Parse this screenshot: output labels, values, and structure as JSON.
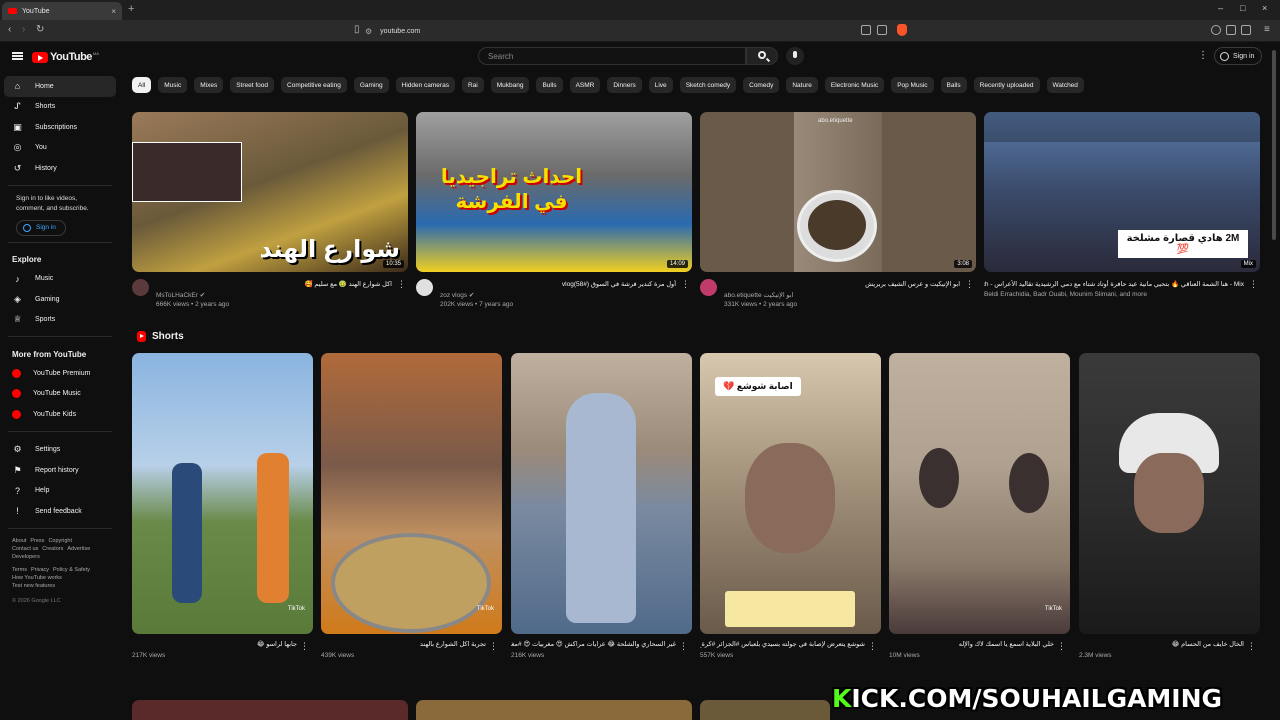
{
  "browser": {
    "tab_title": "YouTube",
    "tab_close": "×",
    "new_tab": "+",
    "url": "youtube.com",
    "window_controls": [
      "–",
      "□",
      "×"
    ]
  },
  "header": {
    "logo_text": "YouTube",
    "logo_region": "MA",
    "search_placeholder": "Search",
    "signin_label": "Sign in"
  },
  "sidebar": {
    "main": [
      {
        "label": "Home",
        "icon": "home-icon"
      },
      {
        "label": "Shorts",
        "icon": "shorts-icon"
      },
      {
        "label": "Subscriptions",
        "icon": "subscriptions-icon"
      },
      {
        "label": "You",
        "icon": "you-icon"
      },
      {
        "label": "History",
        "icon": "history-icon"
      }
    ],
    "signin_note": "Sign in to like videos, comment, and subscribe.",
    "signin_button": "Sign in",
    "explore_heading": "Explore",
    "explore": [
      {
        "label": "Music",
        "icon": "music-icon"
      },
      {
        "label": "Gaming",
        "icon": "gaming-icon"
      },
      {
        "label": "Sports",
        "icon": "trophy-icon"
      }
    ],
    "more_heading": "More from YouTube",
    "more": [
      {
        "label": "YouTube Premium"
      },
      {
        "label": "YouTube Music"
      },
      {
        "label": "YouTube Kids"
      }
    ],
    "settings": [
      {
        "label": "Settings",
        "icon": "gear-icon"
      },
      {
        "label": "Report history",
        "icon": "flag-icon"
      },
      {
        "label": "Help",
        "icon": "help-icon"
      },
      {
        "label": "Send feedback",
        "icon": "feedback-icon"
      }
    ],
    "footer_1": [
      "About",
      "Press",
      "Copyright"
    ],
    "footer_2": [
      "Contact us",
      "Creators",
      "Advertise"
    ],
    "footer_3": [
      "Developers"
    ],
    "footer_4": [
      "Terms",
      "Privacy",
      "Policy & Safety"
    ],
    "footer_5": [
      "How YouTube works"
    ],
    "footer_6": [
      "Test new features"
    ],
    "copyright": "© 2026 Google LLC"
  },
  "chips": [
    "All",
    "Music",
    "Mixes",
    "Street food",
    "Competitive eating",
    "Gaming",
    "Hidden cameras",
    "Rai",
    "Mukbang",
    "Bulls",
    "ASMR",
    "Dinners",
    "Live",
    "Sketch comedy",
    "Comedy",
    "Nature",
    "Electronic Music",
    "Pop Music",
    "Balls",
    "Recently uploaded",
    "Watched"
  ],
  "videos": [
    {
      "title": "اكل شوارع الهند 🤢 مع سليم 🥰",
      "channel": "MsToLHaCkEr ✔",
      "stats": "666K views • 2 years ago",
      "duration": "10:35",
      "overlay_text": "شوارع الهند",
      "color_top": "#7a5a3a",
      "color_bot": "#3b2a1a"
    },
    {
      "title": "أول مرة كندير فرشة في السوق (vlog(58#",
      "channel": "zoz vlogs ✔",
      "stats": "202K views • 7 years ago",
      "duration": "14:09",
      "overlay_text": "احداث تراجيديا في الفرشة",
      "color_top": "#8a8a8a",
      "color_bot": "#2a6ab0"
    },
    {
      "title": "ابو الإتيكيت و عرس الشيف بربريش",
      "channel": "abo.etiquette ابو الإتيكيت",
      "stats": "331K views • 2 years ago",
      "duration": "3:08",
      "overlay_text": "abo.etiquette",
      "color_top": "#8b7b6a",
      "color_bot": "#5a4a3a"
    },
    {
      "title": "Mix - هنا الشمة العناقي 🔥 بتحيي مانية عيد حافرة أوتاد شتاء مع دمي الرشيدية تقاليد الأعراس - bni3ich",
      "channel": "Beldi Errachidia, Badr Ouabi, Mounim Slimani, and more",
      "stats": "",
      "duration": "Mix",
      "overlay_text": "2M  هادي قصارة مشلخة 💯",
      "color_top": "#4a6a9a",
      "color_bot": "#2a2a3a"
    }
  ],
  "shorts_heading": "Shorts",
  "shorts": [
    {
      "title": "جابها لراسو 😂",
      "views": "217K views",
      "color_top": "#8ab4e0",
      "color_bot": "#5a7a3a"
    },
    {
      "title": "تجربة اكل الشوارع بالهند",
      "views": "439K views",
      "color_top": "#b06a3a",
      "color_bot": "#d07a1a"
    },
    {
      "title": "غير السحاري والشلحة 😂 عرايات مراكش 😍 مغربيات 😍 #مغرب_من_الداخل #تريند #رقص_شعبي",
      "views": "216K views",
      "color_top": "#a09080",
      "color_bot": "#506a8a"
    },
    {
      "title": "شوشع يتعرض لإصابة في جولته بسيدي بلعباس #الجزائر #كرة_القدم #السعودية #الجزائريين #ترند",
      "views": "557K views",
      "overlay_text": "اصابة شوشع 💔",
      "color_top": "#d8c8b0",
      "color_bot": "#6a5a4a"
    },
    {
      "title": "خلي البلاية اسمع يا اسمك لاك والإله",
      "views": "10M views",
      "color_top": "#c0b0a0",
      "color_bot": "#4a3a3a"
    },
    {
      "title": "الخال خايف من الحسام 😂",
      "views": "2.3M views",
      "color_top": "#3a3a3a",
      "color_bot": "#1a1a1a"
    }
  ],
  "overlay_banner": "KICK.COM/SOUHAILGAMING"
}
